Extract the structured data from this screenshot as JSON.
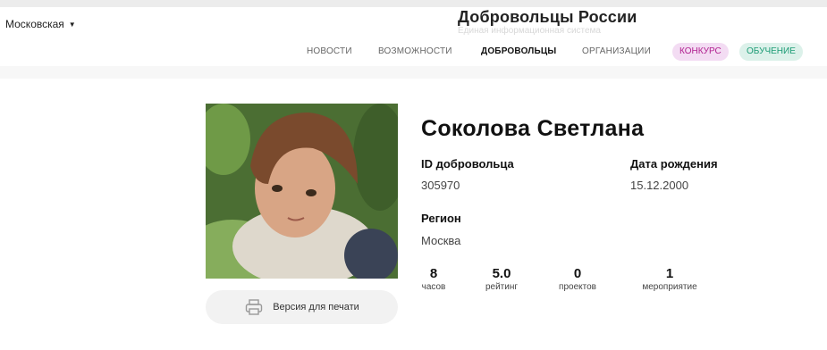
{
  "header": {
    "region": "Московская",
    "logo_title": "Добровольцы России",
    "logo_subtitle": "Единая информационная система"
  },
  "nav": {
    "items": [
      {
        "label": "НОВОСТИ"
      },
      {
        "label": "ВОЗМОЖНОСТИ"
      },
      {
        "label": "ДОБРОВОЛЬЦЫ",
        "active": true
      },
      {
        "label": "ОРГАНИЗАЦИИ"
      }
    ],
    "pill_contest": "КОНКУРС",
    "pill_learning": "ОБУЧЕНИЕ"
  },
  "profile": {
    "name": "Соколова Светлана",
    "id_label": "ID добровольца",
    "id_value": "305970",
    "birth_label": "Дата рождения",
    "birth_value": "15.12.2000",
    "region_label": "Регион",
    "region_value": "Москва",
    "print_label": "Версия для печати",
    "photo_icon": "volunteer-photo"
  },
  "stats": [
    {
      "value": "8",
      "label": "часов"
    },
    {
      "value": "5.0",
      "label": "рейтинг"
    },
    {
      "value": "0",
      "label": "проектов"
    },
    {
      "value": "1",
      "label": "мероприятие"
    }
  ],
  "colors": {
    "contest_bg": "#f3dcf3",
    "contest_text": "#b0208f",
    "learning_bg": "#dcf1ea",
    "learning_text": "#1c9b75"
  }
}
